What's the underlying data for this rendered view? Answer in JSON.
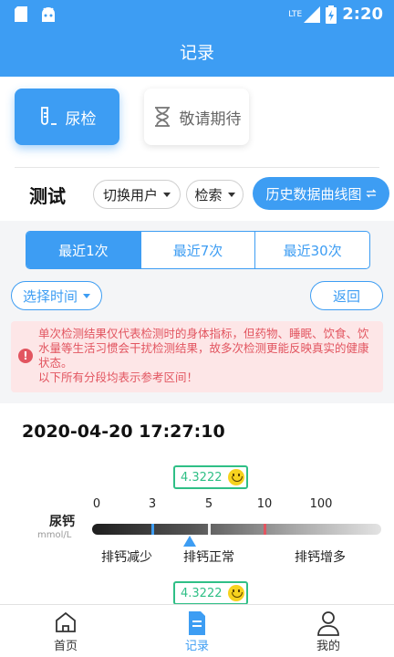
{
  "status_bar": {
    "time": "2:20",
    "network": "LTE"
  },
  "header": {
    "title": "记录"
  },
  "tiles": {
    "urine": "尿检",
    "coming_soon": "敬请期待"
  },
  "toolbar": {
    "title": "测试",
    "switch_user": "切换用户",
    "search": "检索",
    "history_curve": "历史数据曲线图"
  },
  "range_tabs": [
    "最近1次",
    "最近7次",
    "最近30次"
  ],
  "filters": {
    "select_time": "选择时间",
    "back": "返回"
  },
  "notice": {
    "text": "单次检测结果仅代表检测时的身体指标，但药物、睡眠、饮食、饮水量等生活习惯会干扰检测结果，故多次检测更能反映真实的健康状态。",
    "text2": "以下所有分段均表示参考区间！"
  },
  "record": {
    "timestamp": "2020-04-20 17:27:10"
  },
  "chart_data": {
    "type": "gauge",
    "label": "尿钙",
    "unit": "mmol/L",
    "value": 4.3222,
    "value_label": "4.3222",
    "ticks": [
      0,
      3,
      5,
      10,
      100
    ],
    "tick_labels": [
      "0",
      "3",
      "5",
      "10",
      "100"
    ],
    "ranges": [
      {
        "label": "排钙减少"
      },
      {
        "label": "排钙正常"
      },
      {
        "label": "排钙增多"
      }
    ]
  },
  "next_record": {
    "value_label": "4.3222"
  },
  "tabbar": {
    "home": "首页",
    "records": "记录",
    "mine": "我的"
  },
  "colors": {
    "primary": "#3d9df3",
    "normal": "#2fbf86",
    "warning": "#e25560",
    "marker_low": "#3d9df3",
    "marker_high": "#e25560"
  }
}
